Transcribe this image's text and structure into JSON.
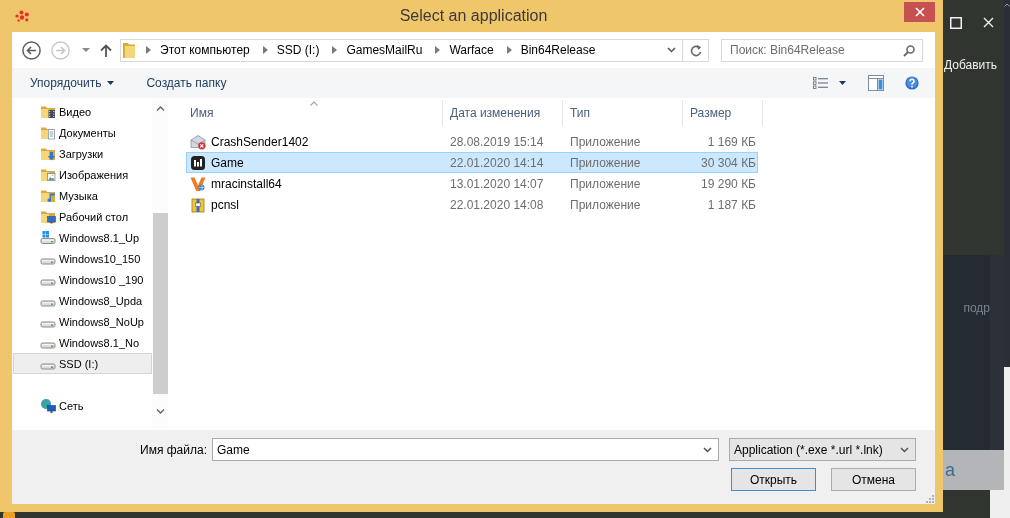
{
  "window": {
    "title": "Select an application"
  },
  "navigation": [
    {
      "kind": "back",
      "disabled": false
    },
    {
      "kind": "forward",
      "disabled": true
    }
  ],
  "address_bar": {
    "crumbs": [
      "Этот компьютер",
      "SSD (I:)",
      "GamesMailRu",
      "Warface",
      "Bin64Release"
    ]
  },
  "search": {
    "placeholder": "Поиск: Bin64Release"
  },
  "toolbar": {
    "items": [
      {
        "label": "Упорядочить",
        "kind": "menu"
      },
      {
        "label": "Создать папку",
        "kind": "button"
      }
    ]
  },
  "sidebar": {
    "groups": [
      {
        "items": [
          {
            "label": "Видео",
            "kind": "video",
            "selected": false
          },
          {
            "label": "Документы",
            "kind": "documents",
            "selected": false
          },
          {
            "label": "Загрузки",
            "kind": "downloads",
            "selected": false
          },
          {
            "label": "Изображения",
            "kind": "pictures",
            "selected": false
          },
          {
            "label": "Музыка",
            "kind": "music",
            "selected": false
          },
          {
            "label": "Рабочий стол",
            "kind": "desktop",
            "selected": false
          },
          {
            "label": "Windows8.1_Up",
            "kind": "osdrive",
            "selected": false
          },
          {
            "label": "Windows10_150",
            "kind": "drive",
            "selected": false
          },
          {
            "label": "Windows10 _190",
            "kind": "drive",
            "selected": false
          },
          {
            "label": "Windows8_Upda",
            "kind": "drive",
            "selected": false
          },
          {
            "label": "Windows8_NoUp",
            "kind": "drive",
            "selected": false
          },
          {
            "label": "Windows8.1_No",
            "kind": "drive",
            "selected": false
          },
          {
            "label": "SSD (I:)",
            "kind": "drive",
            "selected": true
          }
        ]
      },
      {
        "items": [
          {
            "label": "Сеть",
            "kind": "network",
            "selected": false
          }
        ]
      }
    ]
  },
  "files": {
    "columns": [
      {
        "label": "Имя",
        "sorted": true
      },
      {
        "label": "Дата изменения",
        "sorted": false
      },
      {
        "label": "Тип",
        "sorted": false
      },
      {
        "label": "Размер",
        "sorted": false
      }
    ],
    "rows": [
      {
        "kind": "mailer",
        "name": "CrashSender1402",
        "modified": "28.08.2019 15:14",
        "type": "Приложение",
        "size": "1 169 КБ",
        "selected": false
      },
      {
        "kind": "game",
        "name": "Game",
        "modified": "22.01.2020 14:14",
        "type": "Приложение",
        "size": "30 304 КБ",
        "selected": true
      },
      {
        "kind": "installer",
        "name": "mracinstall64",
        "modified": "13.01.2020 14:07",
        "type": "Приложение",
        "size": "19 290 КБ",
        "selected": false
      },
      {
        "kind": "archive",
        "name": "pcnsl",
        "modified": "22.01.2020 14:08",
        "type": "Приложение",
        "size": "1 187 КБ",
        "selected": false
      }
    ]
  },
  "footer": {
    "filename_label": "Имя файла:",
    "filename": "Game",
    "filetype": "Application (*.exe *.url *.lnk)",
    "buttons": [
      {
        "label": "Открыть",
        "default": true
      },
      {
        "label": "Отмена",
        "default": false
      }
    ]
  },
  "background_window": {
    "button": "Добавить",
    "faint_text": "подр",
    "bar_text": "а"
  }
}
